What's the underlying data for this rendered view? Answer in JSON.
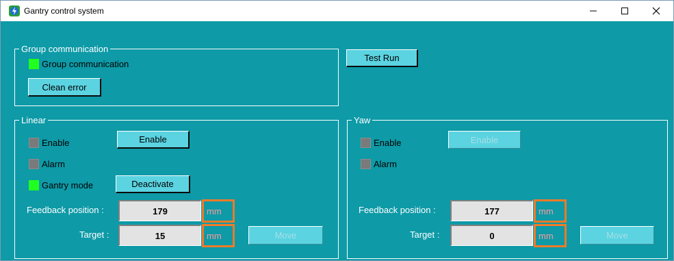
{
  "window": {
    "title": "Gantry control system",
    "minimize_label": "—",
    "maximize_label": "☐",
    "close_label": "✕"
  },
  "group_comm": {
    "legend": "Group communication",
    "indicator_label": "Group communication",
    "indicator_state": "on",
    "clean_error_label": "Clean error"
  },
  "test_run_label": "Test Run",
  "linear": {
    "legend": "Linear",
    "enable_label": "Enable",
    "enable_button": "Enable",
    "alarm_label": "Alarm",
    "gantry_mode_label": "Gantry mode",
    "deactivate_button": "Deactivate",
    "feedback_label": "Feedback position :",
    "feedback_value": "179",
    "feedback_unit": "mm",
    "target_label": "Target :",
    "target_value": "15",
    "target_unit": "mm",
    "move_button": "Move"
  },
  "yaw": {
    "legend": "Yaw",
    "enable_label": "Enable",
    "enable_button": "Enable",
    "alarm_label": "Alarm",
    "feedback_label": "Feedback position :",
    "feedback_value": "177",
    "feedback_unit": "mm",
    "target_label": "Target :",
    "target_value": "0",
    "target_unit": "mm",
    "move_button": "Move"
  },
  "colors": {
    "background": "#0e9aa7",
    "button_face": "#5bd3e1",
    "led_on": "#21ff21",
    "led_off": "#7a7a7a",
    "unit_highlight": "#f07b28"
  }
}
